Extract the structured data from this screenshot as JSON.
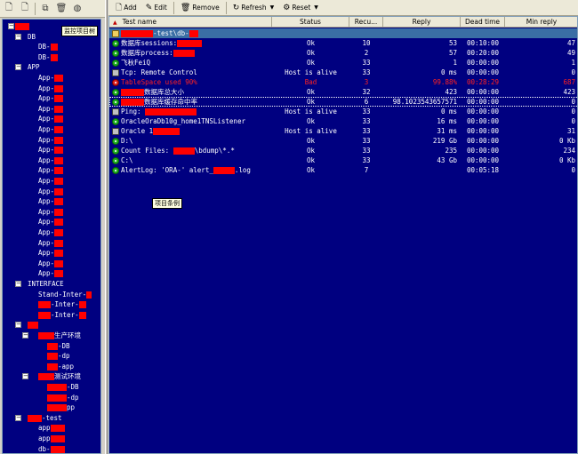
{
  "left_toolbar": {
    "buttons": [
      "new-file-icon",
      "new-folder-icon",
      "properties-icon",
      "delete-icon",
      "monitor-icon"
    ]
  },
  "tree": {
    "tooltip": "监控项目树",
    "nodes": [
      {
        "label": "",
        "level": 0,
        "expander": "-",
        "red": 16
      },
      {
        "label": "DB",
        "level": 1,
        "expander": "-"
      },
      {
        "label": "DB-",
        "level": 2,
        "red": 8
      },
      {
        "label": "DB-",
        "level": 2,
        "red": 8
      },
      {
        "label": "APP",
        "level": 1,
        "expander": "-"
      },
      {
        "label": "App-",
        "level": 2,
        "red": 10
      },
      {
        "label": "App-",
        "level": 2,
        "red": 10
      },
      {
        "label": "App-",
        "level": 2,
        "red": 10
      },
      {
        "label": "App-",
        "level": 2,
        "red": 10
      },
      {
        "label": "App-",
        "level": 2,
        "red": 10
      },
      {
        "label": "App-",
        "level": 2,
        "red": 10
      },
      {
        "label": "App-",
        "level": 2,
        "red": 10
      },
      {
        "label": "App-",
        "level": 2,
        "red": 10
      },
      {
        "label": "App-",
        "level": 2,
        "red": 10
      },
      {
        "label": "App-",
        "level": 2,
        "red": 10
      },
      {
        "label": "App-",
        "level": 2,
        "red": 10
      },
      {
        "label": "App-",
        "level": 2,
        "red": 10
      },
      {
        "label": "App-",
        "level": 2,
        "red": 10
      },
      {
        "label": "App-",
        "level": 2,
        "red": 10
      },
      {
        "label": "App-",
        "level": 2,
        "red": 10
      },
      {
        "label": "App-",
        "level": 2,
        "red": 10
      },
      {
        "label": "App-",
        "level": 2,
        "red": 10
      },
      {
        "label": "App-",
        "level": 2,
        "red": 10
      },
      {
        "label": "App-",
        "level": 2,
        "red": 10
      },
      {
        "label": "App-",
        "level": 2,
        "red": 10
      },
      {
        "label": "INTERFACE",
        "level": 1,
        "expander": "-"
      },
      {
        "label": "Stand-Inter-",
        "level": 2,
        "red": 6
      },
      {
        "label": "-Inter-",
        "level": 2,
        "red": 8,
        "redlead": 14
      },
      {
        "label": "-Inter-",
        "level": 2,
        "red": 8,
        "redlead": 14
      },
      {
        "label": "",
        "level": 1,
        "expander": "-",
        "red": 12
      },
      {
        "label": "生产环境",
        "level": 2,
        "expander": "-",
        "redlead": 18
      },
      {
        "label": "-DB",
        "level": 3,
        "redlead": 12
      },
      {
        "label": "-dp",
        "level": 3,
        "redlead": 12
      },
      {
        "label": "-app",
        "level": 3,
        "redlead": 12
      },
      {
        "label": "测试环境",
        "level": 2,
        "expander": "-",
        "redlead": 18
      },
      {
        "label": "-DB",
        "level": 3,
        "redlead": 22
      },
      {
        "label": "-dp",
        "level": 3,
        "redlead": 22
      },
      {
        "label": "pp",
        "level": 3,
        "redlead": 22
      },
      {
        "label": "-test",
        "level": 1,
        "expander": "-",
        "redlead": 16
      },
      {
        "label": "app",
        "level": 2,
        "red": 16
      },
      {
        "label": "app",
        "level": 2,
        "red": 16
      },
      {
        "label": "db-",
        "level": 2,
        "red": 16
      }
    ]
  },
  "right_toolbar": {
    "add": "Add",
    "edit": "Edit",
    "remove": "Remove",
    "refresh": "Refresh",
    "reset": "Reset"
  },
  "grid": {
    "columns": [
      "Test name",
      "Status",
      "Recu...",
      "Reply",
      "Dead time",
      "Min reply"
    ],
    "tooltip": "项目条例",
    "rows": [
      {
        "icon": "folder",
        "name": "-test\\db-",
        "red_lead": 36,
        "red_tail": 10,
        "status": "",
        "recu": "",
        "reply": "",
        "dead": "",
        "min": "",
        "selected": true
      },
      {
        "icon": "ok",
        "name": "数据库sessions:",
        "red_tail": 28,
        "status": "Ok",
        "recu": "10",
        "reply": "53",
        "dead": "00:10:00",
        "min": "47"
      },
      {
        "icon": "ok",
        "name": "数据库process:",
        "red_tail": 24,
        "status": "Ok",
        "recu": "2",
        "reply": "57",
        "dead": "00:20:00",
        "min": "49"
      },
      {
        "icon": "ok",
        "name": "飞秋FeiQ",
        "status": "Ok",
        "recu": "33",
        "reply": "1",
        "dead": "00:00:00",
        "min": "1"
      },
      {
        "icon": "net",
        "name": "Tcp: Remote Control",
        "status": "Host is alive",
        "recu": "33",
        "reply": "0 ms",
        "dead": "00:00:00",
        "min": "0"
      },
      {
        "icon": "bad",
        "name": "TableSpace used 90%",
        "status": "Bad",
        "recu": "3",
        "reply": "99.88%",
        "dead": "00:28:29",
        "min": "687",
        "bad": true
      },
      {
        "icon": "ok",
        "name": "数据库总大小",
        "red_lead": 26,
        "status": "Ok",
        "recu": "32",
        "reply": "423",
        "dead": "00:00:00",
        "min": "423"
      },
      {
        "icon": "ok",
        "name": "数据库缓存命中率",
        "red_lead": 26,
        "status": "Ok",
        "recu": "6",
        "reply": "98.1023543657571",
        "dead": "00:00:00",
        "min": "0",
        "focus": true
      },
      {
        "icon": "net",
        "name": "Ping: ",
        "red_tail": 58,
        "status": "Host is alive",
        "recu": "33",
        "reply": "0 ms",
        "dead": "00:00:00",
        "min": "0"
      },
      {
        "icon": "ok",
        "name": "OracleOraDb10g_home1TNSListener",
        "status": "Ok",
        "recu": "33",
        "reply": "16 ms",
        "dead": "00:00:00",
        "min": "0"
      },
      {
        "icon": "net",
        "name": "Oracle 1",
        "red_tail": 30,
        "status": "Host is alive",
        "recu": "33",
        "reply": "31 ms",
        "dead": "00:00:00",
        "min": "31"
      },
      {
        "icon": "ok",
        "name": "D:\\",
        "status": "Ok",
        "recu": "33",
        "reply": "219 Gb",
        "dead": "00:00:00",
        "min": "0 Kb"
      },
      {
        "icon": "ok",
        "name": "Count Files: ",
        "red_tail": 24,
        "after": "\\bdump\\*.*",
        "status": "Ok",
        "recu": "33",
        "reply": "235",
        "dead": "00:00:00",
        "min": "234"
      },
      {
        "icon": "ok",
        "name": "C:\\",
        "status": "Ok",
        "recu": "33",
        "reply": "43 Gb",
        "dead": "00:00:00",
        "min": "0 Kb"
      },
      {
        "icon": "ok",
        "name": "AlertLog: 'ORA-' alert_",
        "red_tail": 24,
        "after": ".log",
        "status": "Ok",
        "recu": "7",
        "reply": "",
        "dead": "00:05:18",
        "min": "0"
      }
    ]
  }
}
